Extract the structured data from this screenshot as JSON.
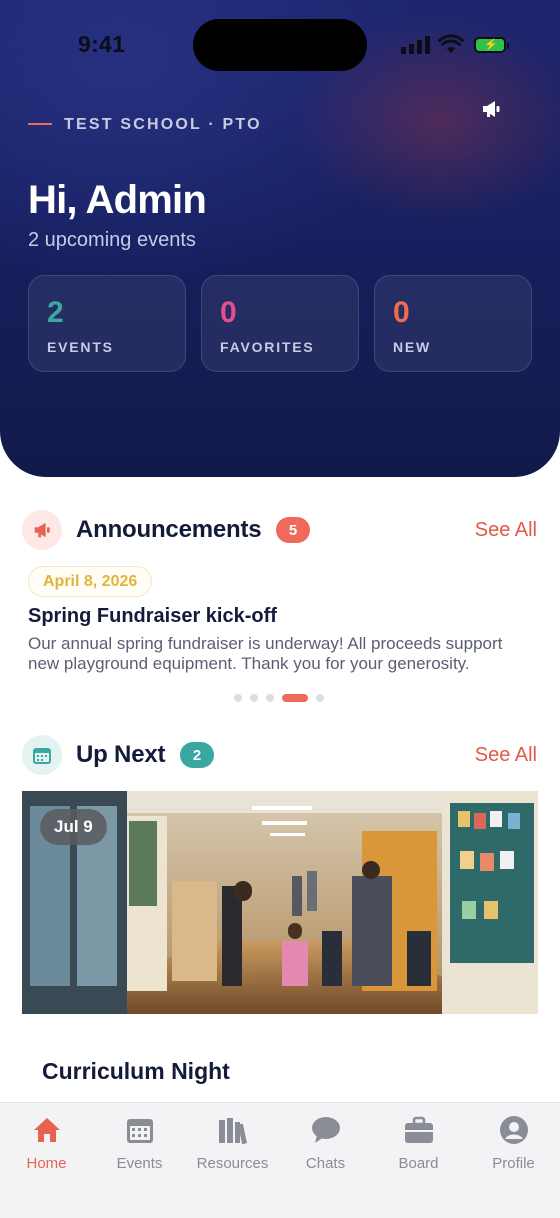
{
  "status_bar": {
    "time": "9:41"
  },
  "header": {
    "org": "TEST SCHOOL · PTO",
    "greeting": "Hi, Admin",
    "subtitle": "2 upcoming events"
  },
  "stats": [
    {
      "value": "2",
      "label": "EVENTS",
      "color": "#3aa7a0"
    },
    {
      "value": "0",
      "label": "FAVORITES",
      "color": "#e34f8f"
    },
    {
      "value": "0",
      "label": "NEW",
      "color": "#f06a4e"
    }
  ],
  "announcements": {
    "title": "Announcements",
    "count": "5",
    "see_all": "See All",
    "item": {
      "date": "April 8, 2026",
      "title": "Spring Fundraiser kick-off",
      "body": "Our annual spring fundraiser is underway! All proceeds support new playground equipment. Thank you for your generosity."
    },
    "carousel_active_index": 3,
    "carousel_total": 5
  },
  "up_next": {
    "title": "Up Next",
    "count": "2",
    "see_all": "See All",
    "event": {
      "date": "Jul 9",
      "title": "Curriculum Night"
    }
  },
  "tabs": [
    {
      "label": "Home",
      "icon": "home-icon",
      "active": true
    },
    {
      "label": "Events",
      "icon": "calendar-icon",
      "active": false
    },
    {
      "label": "Resources",
      "icon": "books-icon",
      "active": false
    },
    {
      "label": "Chats",
      "icon": "chat-bubble-icon",
      "active": false
    },
    {
      "label": "Board",
      "icon": "briefcase-icon",
      "active": false
    },
    {
      "label": "Profile",
      "icon": "person-icon",
      "active": false
    }
  ],
  "colors": {
    "accent": "#e8634f",
    "teal": "#3aa7a0",
    "hero_bg": "#172060"
  }
}
